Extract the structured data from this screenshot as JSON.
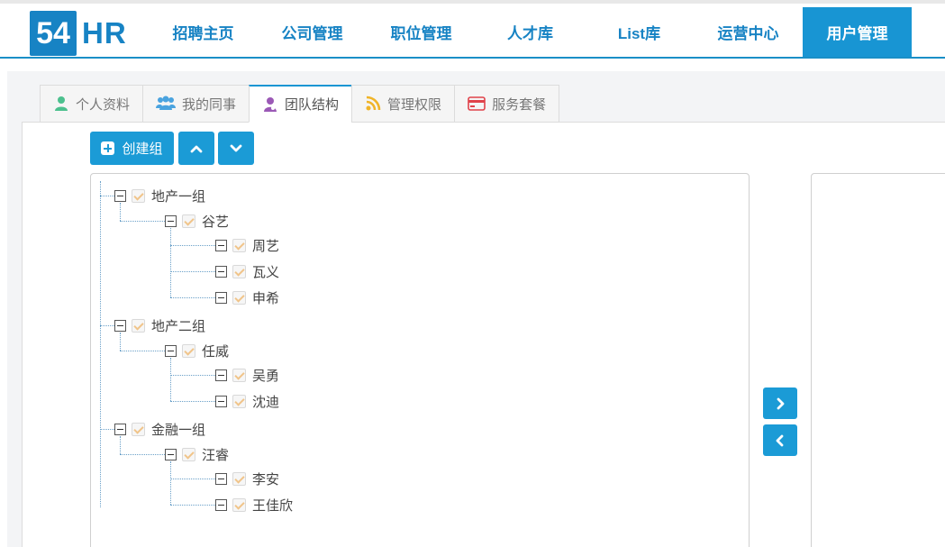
{
  "brand": {
    "logo_box": "54",
    "logo_text": "HR"
  },
  "nav": {
    "items": [
      {
        "label": "招聘主页",
        "active": false
      },
      {
        "label": "公司管理",
        "active": false
      },
      {
        "label": "职位管理",
        "active": false
      },
      {
        "label": "人才库",
        "active": false
      },
      {
        "label": "List库",
        "active": false
      },
      {
        "label": "运营中心",
        "active": false
      },
      {
        "label": "用户管理",
        "active": true
      }
    ]
  },
  "tabs": [
    {
      "label": "个人资料",
      "icon": "user-icon",
      "color": "#4cc08e"
    },
    {
      "label": "我的同事",
      "icon": "users-icon",
      "color": "#4aa3df"
    },
    {
      "label": "团队结构",
      "icon": "team-structure-icon",
      "color": "#9b59b6",
      "active": true
    },
    {
      "label": "管理权限",
      "icon": "rss-icon",
      "color": "#f0b429"
    },
    {
      "label": "服务套餐",
      "icon": "credit-card-icon",
      "color": "#e0434b"
    }
  ],
  "toolbar": {
    "create_label": "创建组"
  },
  "tree": {
    "groups": [
      {
        "name": "地产一组",
        "leader": "谷艺",
        "members": [
          "周艺",
          "瓦义",
          "申希"
        ]
      },
      {
        "name": "地产二组",
        "leader": "任威",
        "members": [
          "吴勇",
          "沈迪"
        ]
      },
      {
        "name": "金融一组",
        "leader": "汪睿",
        "members": [
          "李安",
          "王佳欣"
        ]
      }
    ]
  },
  "colors": {
    "accent": "#1895d3",
    "brand": "#1783c4",
    "check": "#f0c48a"
  }
}
